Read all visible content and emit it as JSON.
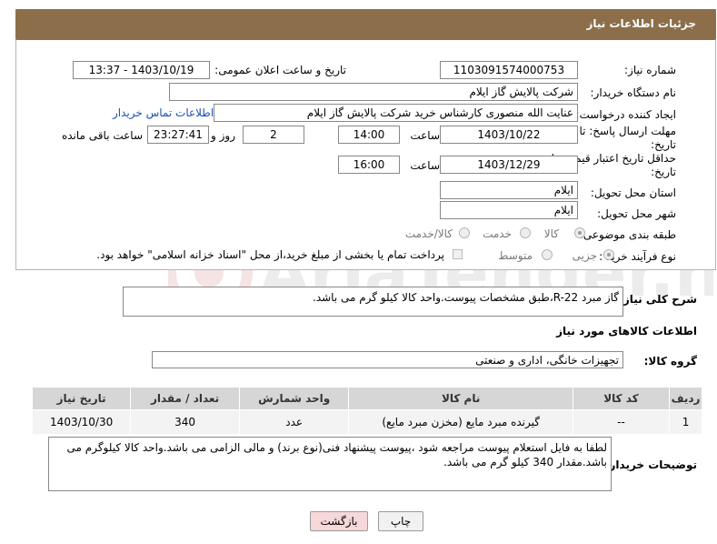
{
  "header": {
    "title": "جزئیات اطلاعات نیاز"
  },
  "form": {
    "need_number_label": "شماره نیاز:",
    "need_number": "1103091574000753",
    "announce_label": "تاریخ و ساعت اعلان عمومی:",
    "announce_value": "1403/10/19 - 13:37",
    "buyer_org_label": "نام دستگاه خریدار:",
    "buyer_org": "شرکت پالایش گاز ایلام",
    "creator_label": "ایجاد کننده درخواست:",
    "creator": "عنایت الله منصوری کارشناس خرید شرکت پالایش گاز ایلام",
    "contact_link": "اطلاعات تماس خریدار",
    "reply_deadline_label": "مهلت ارسال پاسخ: تا",
    "reply_deadline_label2": "تاریخ:",
    "reply_date": "1403/10/22",
    "time_label": "ساعت",
    "reply_time": "14:00",
    "days_value": "2",
    "days_label": "روز و",
    "remaining_time": "23:27:41",
    "remaining_label": "ساعت باقی مانده",
    "validity_label": "حداقل تاریخ اعتبار قیمت: تا",
    "validity_label2": "تاریخ:",
    "validity_date": "1403/12/29",
    "validity_time": "16:00",
    "province_label": "استان محل تحویل:",
    "province": "ایلام",
    "city_label": "شهر محل تحویل:",
    "city": "ایلام",
    "category_label": "طبقه بندی موضوعی:",
    "category_options": [
      "کالا",
      "خدمت",
      "کالا/خدمت"
    ],
    "process_label": "نوع فرآیند خرید :",
    "process_options": [
      "جزیی",
      "متوسط"
    ],
    "payment_note": "پرداخت تمام یا بخشی از مبلغ خرید،از محل \"اسناد خزانه اسلامی\" خواهد بود."
  },
  "description": {
    "label": "شرح کلی نیاز:",
    "value": "گاز مبرد R-22،طبق مشخصات پیوست.واحد کالا کیلو گرم می باشد."
  },
  "goods_section_title": "اطلاعات کالاهای مورد نیاز",
  "goods_group": {
    "label": "گروه کالا:",
    "value": "تجهیزات خانگی، اداری و صنعتی"
  },
  "table": {
    "headers": [
      "ردیف",
      "کد کالا",
      "نام کالا",
      "واحد شمارش",
      "تعداد / مقدار",
      "تاریخ نیاز"
    ],
    "rows": [
      [
        "1",
        "--",
        "گیرنده مبرد مایع (مخزن مبرد مایع)",
        "عدد",
        "340",
        "1403/10/30"
      ]
    ]
  },
  "buyer_notes": {
    "label": "توضیحات خریدار:",
    "value": "لطفا به فایل استعلام پیوست مراجعه شود ،پیوست پیشنهاد فنی(نوع برند) و مالی الزامی می باشد.واحد کالا کیلوگرم می باشد.مقدار 340 کیلو گرم می باشد."
  },
  "buttons": {
    "print": "چاپ",
    "back": "بازگشت"
  },
  "colors": {
    "header": "#8c6f4a",
    "link": "#1a4fb5",
    "back_button": "#f6d8d8",
    "print_button": "#f1f1f1"
  }
}
